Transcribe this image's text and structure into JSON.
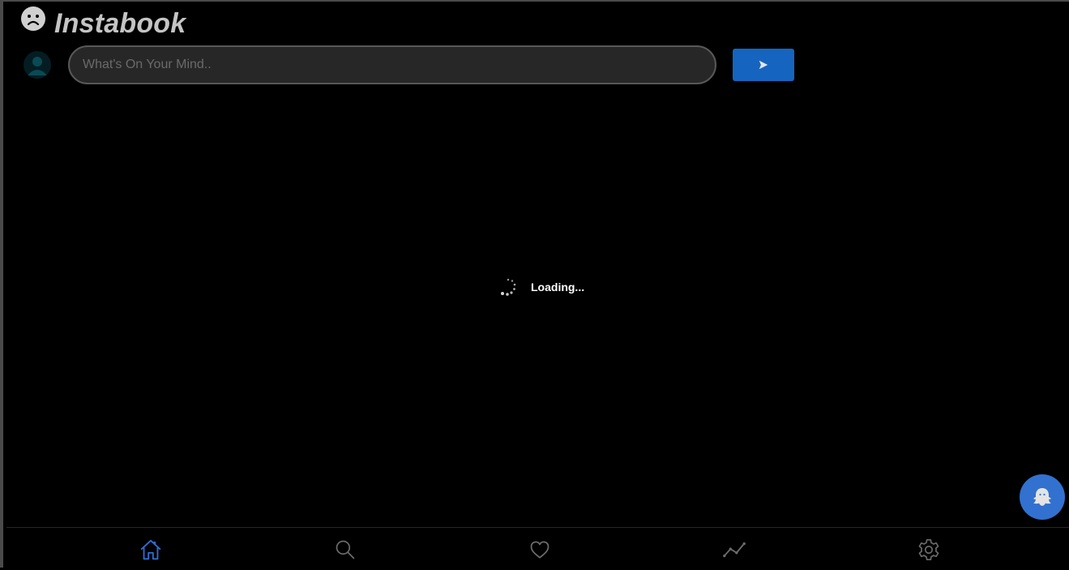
{
  "app": {
    "title": "Instabook",
    "logo_icon": "sad-face-icon"
  },
  "composer": {
    "avatar_icon": "user-avatar-icon",
    "placeholder": "What's On Your Mind..",
    "value": "",
    "send_icon": "send-arrow-icon"
  },
  "status": {
    "loading_text": "Loading..."
  },
  "fab": {
    "icon": "ghost-icon"
  },
  "bottom_nav": {
    "items": [
      {
        "name": "home",
        "icon": "home-icon",
        "active": true
      },
      {
        "name": "search",
        "icon": "search-icon",
        "active": false
      },
      {
        "name": "favorites",
        "icon": "heart-icon",
        "active": false
      },
      {
        "name": "activity",
        "icon": "trend-icon",
        "active": false
      },
      {
        "name": "settings",
        "icon": "gear-icon",
        "active": false
      }
    ]
  },
  "colors": {
    "background": "#000000",
    "accent": "#1565c0",
    "fab": "#3271cf",
    "active_nav": "#2f6ccf",
    "inactive_nav": "#6b6b6b",
    "title": "#c4c4c4"
  }
}
